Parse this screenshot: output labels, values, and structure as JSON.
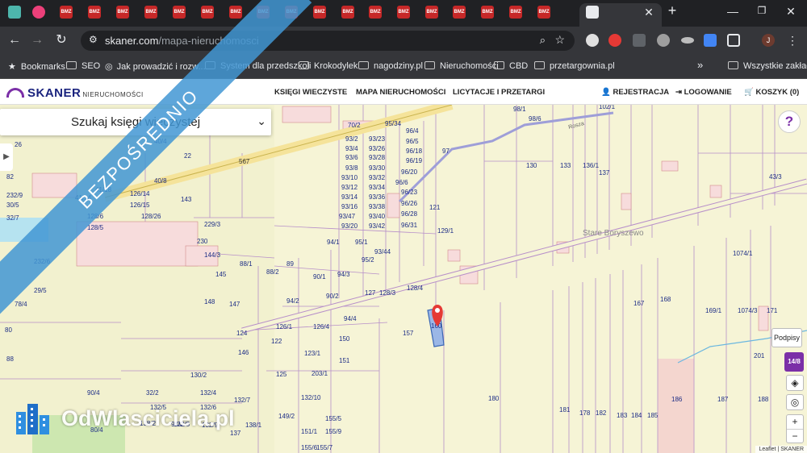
{
  "browser": {
    "url_host": "skaner.com",
    "url_path": "/mapa-nieruchomosci",
    "tabs": [
      "BMZ",
      "BMZ",
      "BMZ",
      "BMZ",
      "BMZ",
      "BMZ",
      "BMZ",
      "BMZ",
      "BMZ",
      "BMZ",
      "BMZ",
      "BMZ",
      "BMZ",
      "BMZ",
      "BMZ",
      "BMZ",
      "BMZ",
      "BMZ"
    ],
    "bookmarks": [
      "Bookmarks",
      "SEO",
      "Jak prowadzić i rozw...",
      "System dla przedszkoli",
      "Krokodylek",
      "nagodziny.pl",
      "Nieruchomości",
      "CBD",
      "przetargownia.pl"
    ],
    "all_bookmarks": "Wszystkie zakładki",
    "more_label": "»",
    "profile_initial": "J"
  },
  "site": {
    "logo": "SKANER",
    "logo_sub": "NIERUCHOMOŚCI",
    "menu": [
      "KSIĘGI WIECZYSTE",
      "MAPA NIERUCHOMOŚCI",
      "LICYTACJE I PRZETARGI"
    ],
    "register": "REJESTRACJA",
    "login": "LOGOWANIE",
    "cart": "KOSZYK (0)"
  },
  "map": {
    "search_label": "Szukaj księgi wieczystej",
    "help": "?",
    "podpisy": "Podpisy",
    "badge": "14/8",
    "zoom_in": "+",
    "zoom_out": "−",
    "attribution": "Leaflet | SKANER",
    "village": "Stare Boryszewo",
    "road": "567",
    "road2": "Rosza",
    "parcels": [
      "70/2",
      "95/34",
      "96/4",
      "96/5",
      "96/18",
      "96/19",
      "96/20",
      "96/6",
      "96/23",
      "96/26",
      "96/28",
      "96/31",
      "93/2",
      "93/23",
      "93/4",
      "93/26",
      "93/6",
      "93/28",
      "93/8",
      "93/30",
      "93/10",
      "93/32",
      "93/12",
      "93/34",
      "93/14",
      "93/36",
      "93/16",
      "93/38",
      "93/47",
      "93/40",
      "93/20",
      "93/42",
      "94/1",
      "95/1",
      "93/44",
      "95/2",
      "97",
      "121",
      "129/1",
      "130",
      "133",
      "136/1",
      "137",
      "98/5",
      "98/1",
      "98/6",
      "102/1",
      "43/3",
      "1074/1",
      "167",
      "168",
      "169/1",
      "1074/3",
      "171",
      "201",
      "186",
      "187",
      "188",
      "128/4",
      "160",
      "157",
      "127",
      "128/3",
      "150",
      "151",
      "203/1",
      "180",
      "181",
      "178",
      "182",
      "183",
      "184",
      "185",
      "22",
      "143",
      "40/4",
      "40/8",
      "41/18",
      "41/14",
      "126/14",
      "126/15",
      "128/6",
      "128/5",
      "128/26",
      "229/3",
      "230",
      "144/3",
      "145",
      "88/1",
      "88/2",
      "89",
      "90/1",
      "94/3",
      "94/2",
      "90/2",
      "94/4",
      "126/4",
      "126/1",
      "122",
      "123/1",
      "125",
      "124",
      "147",
      "146",
      "148",
      "130/2",
      "32/2",
      "132/4",
      "132/5",
      "132/6",
      "132/7",
      "138/1",
      "138/2",
      "132/8",
      "132/9",
      "132/10",
      "149/2",
      "151/1",
      "155/5",
      "155/6",
      "155/9",
      "155/7",
      "139/1",
      "153/4",
      "137",
      "94/2",
      "90/4",
      "88",
      "80",
      "78/4",
      "29/5",
      "232/6",
      "232/9",
      "30/5",
      "32/7",
      "82",
      "26",
      "36",
      "80/4",
      "113",
      "123"
    ],
    "marker_parcel": "160"
  },
  "overlay": {
    "ribbon": "BEZPOŚREDNIO",
    "watermark": "OdWlasciciela.pl"
  }
}
